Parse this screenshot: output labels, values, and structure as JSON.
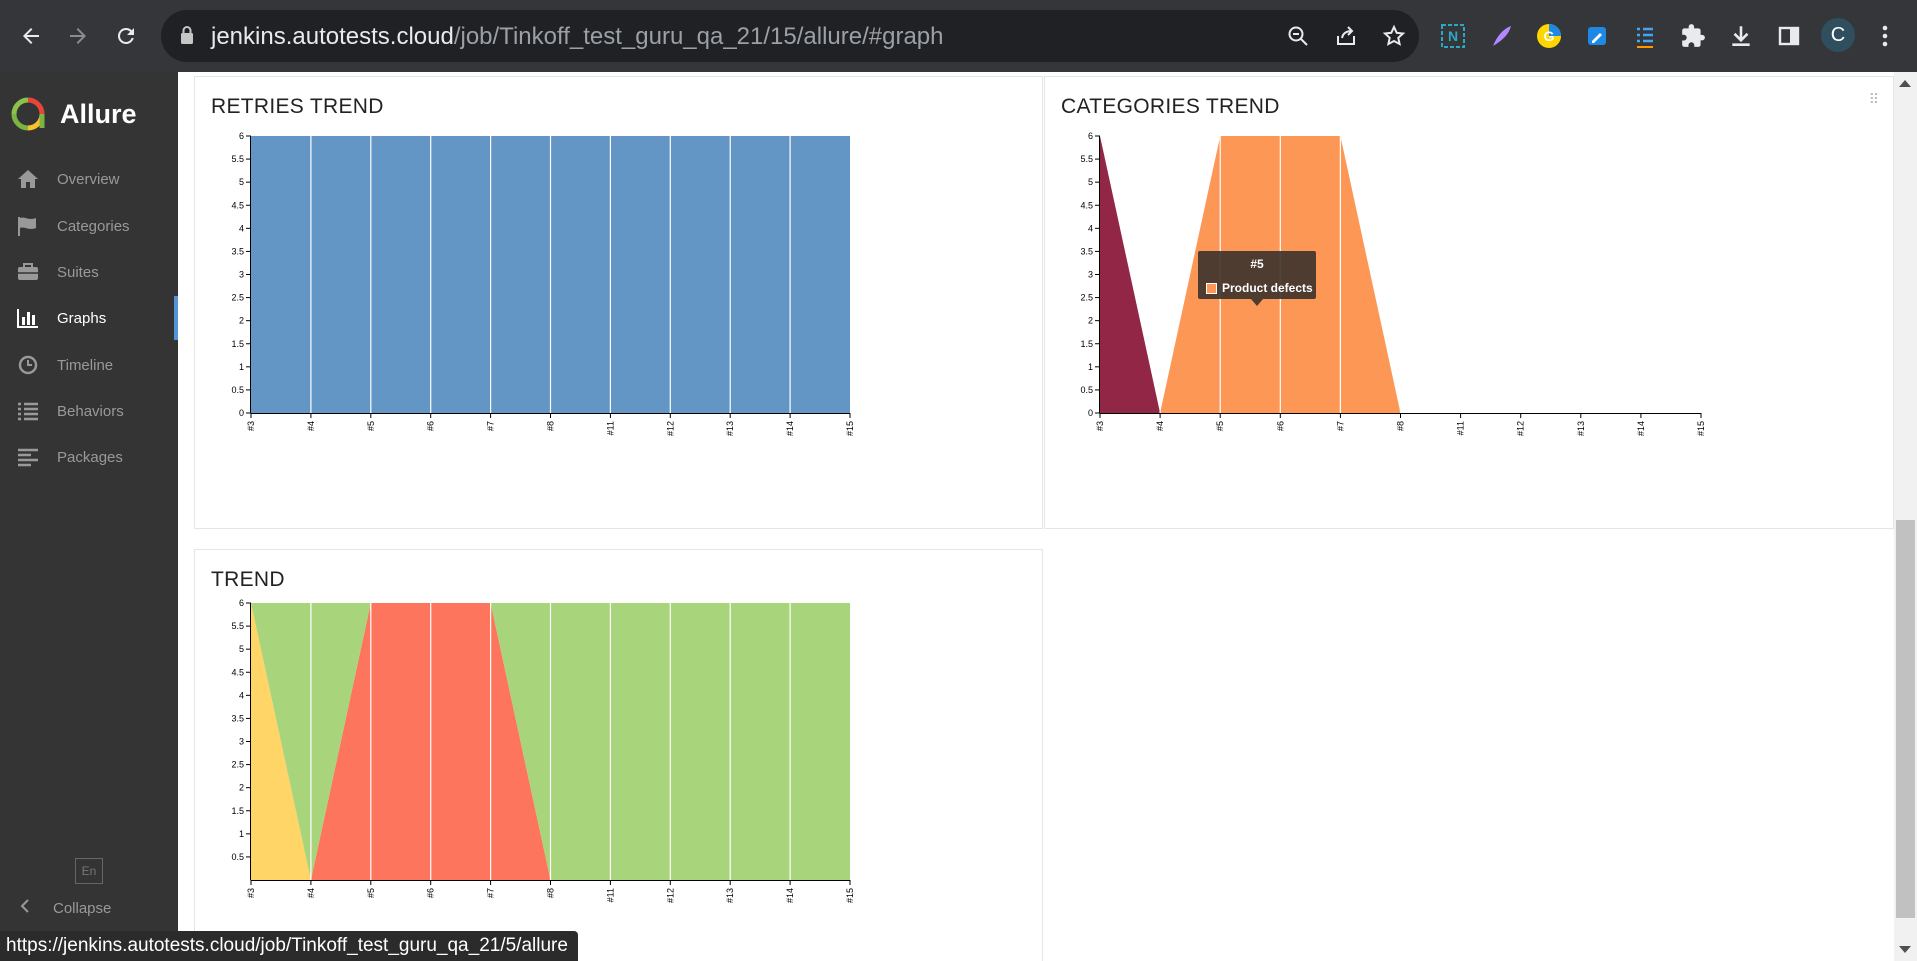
{
  "browser": {
    "url_host": "jenkins.autotests.cloud",
    "url_path": "/job/Tinkoff_test_guru_qa_21/15/allure/#graph",
    "profile_initial": "C"
  },
  "sidebar": {
    "brand": "Allure",
    "items": [
      {
        "label": "Overview",
        "icon": "home-icon"
      },
      {
        "label": "Categories",
        "icon": "flag-icon"
      },
      {
        "label": "Suites",
        "icon": "briefcase-icon"
      },
      {
        "label": "Graphs",
        "icon": "bar-chart-icon",
        "active": true
      },
      {
        "label": "Timeline",
        "icon": "clock-icon"
      },
      {
        "label": "Behaviors",
        "icon": "list-icon"
      },
      {
        "label": "Packages",
        "icon": "align-left-icon"
      }
    ],
    "language": "En",
    "collapse_label": "Collapse"
  },
  "widgets": {
    "retries": {
      "title": "RETRIES TREND"
    },
    "categories": {
      "title": "CATEGORIES TREND"
    },
    "trend": {
      "title": "TREND"
    }
  },
  "tooltip": {
    "title": "#5",
    "label": "Product defects"
  },
  "status_url": "https://jenkins.autotests.cloud/job/Tinkoff_test_guru_qa_21/5/allure",
  "colors": {
    "retries": "#6396c4",
    "product_defects": "#fd9756",
    "test_defects": "#922647",
    "passed": "#a8d47c",
    "failed": "#fe755d",
    "broken": "#ffd567",
    "sidebar_bg": "#343434",
    "accent": "#5294d6"
  },
  "chart_data": [
    {
      "type": "area",
      "title": "RETRIES TREND",
      "categories": [
        "#3",
        "#4",
        "#5",
        "#6",
        "#7",
        "#8",
        "#11",
        "#12",
        "#13",
        "#14",
        "#15"
      ],
      "ylim": [
        0,
        6
      ],
      "yticks": [
        "0",
        "0.5",
        "1",
        "1.5",
        "2",
        "2.5",
        "3",
        "3.5",
        "4",
        "4.5",
        "5",
        "5.5",
        "6"
      ],
      "series": [
        {
          "color": "#6396c4",
          "values": [
            6,
            6,
            6,
            6,
            6,
            6,
            6,
            6,
            6,
            6,
            6
          ]
        }
      ]
    },
    {
      "type": "area",
      "title": "CATEGORIES TREND",
      "categories": [
        "#3",
        "#4",
        "#5",
        "#6",
        "#7",
        "#8",
        "#11",
        "#12",
        "#13",
        "#14",
        "#15"
      ],
      "ylim": [
        0,
        6
      ],
      "yticks": [
        "0",
        "0.5",
        "1",
        "1.5",
        "2",
        "2.5",
        "3",
        "3.5",
        "4",
        "4.5",
        "5",
        "5.5",
        "6"
      ],
      "series": [
        {
          "name": "Product defects",
          "color": "#fd9756",
          "values": [
            0,
            0,
            6,
            6,
            6,
            0,
            0,
            0,
            0,
            0,
            0
          ]
        },
        {
          "color": "#922647",
          "values": [
            6,
            0,
            0,
            0,
            0,
            0,
            0,
            0,
            0,
            0,
            0
          ]
        }
      ]
    },
    {
      "type": "area",
      "title": "TREND",
      "categories": [
        "#3",
        "#4",
        "#5",
        "#6",
        "#7",
        "#8",
        "#11",
        "#12",
        "#13",
        "#14",
        "#15"
      ],
      "ylim": [
        0,
        6
      ],
      "yticks": [
        "0.5",
        "1",
        "1.5",
        "2",
        "2.5",
        "3",
        "3.5",
        "4",
        "4.5",
        "5",
        "5.5",
        "6"
      ],
      "stacked": true,
      "series": [
        {
          "color": "#fe755d",
          "values": [
            0,
            0,
            6,
            6,
            6,
            0,
            0,
            0,
            0,
            0,
            0
          ]
        },
        {
          "color": "#ffd567",
          "values": [
            6,
            0,
            0,
            0,
            0,
            0,
            0,
            0,
            0,
            0,
            0
          ]
        },
        {
          "color": "#a8d47c",
          "values": [
            0,
            6,
            0,
            0,
            0,
            6,
            6,
            6,
            6,
            6,
            6
          ]
        }
      ]
    }
  ]
}
